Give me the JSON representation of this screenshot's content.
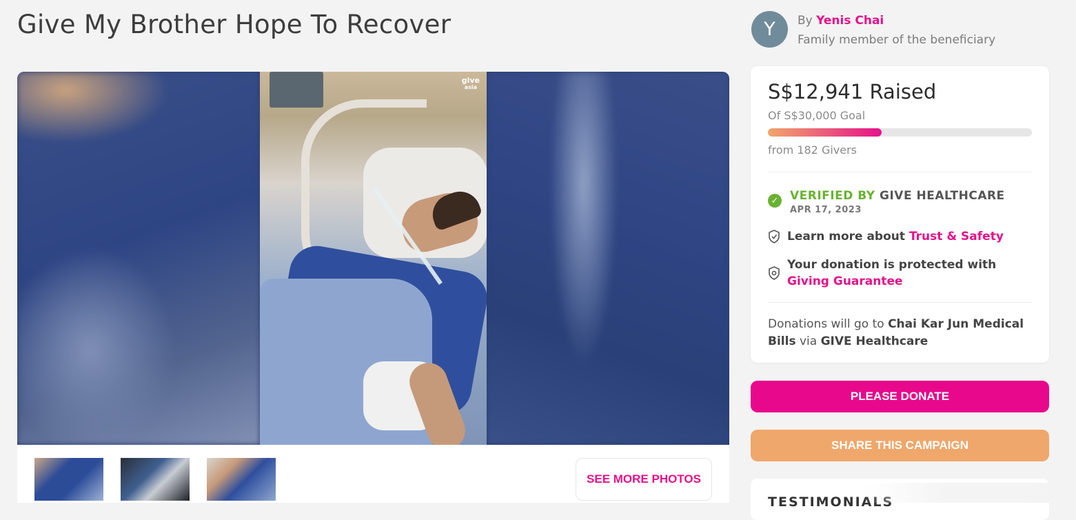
{
  "campaign": {
    "title": "Give My Brother Hope To Recover"
  },
  "media": {
    "watermark_top": "give",
    "watermark_bottom": "asia",
    "see_more_label": "SEE MORE PHOTOS",
    "thumbnail_count": 3
  },
  "organizer": {
    "avatar_letter": "Y",
    "by_prefix": "By",
    "name": "Yenis Chai",
    "relation": "Family member of the beneficiary"
  },
  "fundraising": {
    "raised_text": "S$12,941 Raised",
    "goal_text": "Of S$30,000 Goal",
    "raised_amount": 12941,
    "goal_amount": 30000,
    "progress_fraction": 0.431,
    "givers_text": "from 182 Givers"
  },
  "verification": {
    "verified_by_label": "VERIFIED BY",
    "verifier": "GIVE HEALTHCARE",
    "date": "APR 17, 2023"
  },
  "trust": {
    "learn_prefix": "Learn more about",
    "learn_link": "Trust & Safety",
    "protect_prefix": "Your donation is protected with",
    "protect_link": "Giving Guarantee"
  },
  "beneficiary": {
    "prefix": "Donations will go to",
    "name": "Chai Kar Jun Medical Bills",
    "via": "via",
    "partner": "GIVE Healthcare"
  },
  "actions": {
    "donate_label": "PLEASE DONATE",
    "share_label": "SHARE THIS CAMPAIGN"
  },
  "testimonials": {
    "heading": "TESTIMONIALS"
  },
  "colors": {
    "brand_pink": "#e5128a",
    "share_orange": "#efa76c",
    "verified_green": "#6ab232",
    "avatar_gray": "#708c9a"
  }
}
